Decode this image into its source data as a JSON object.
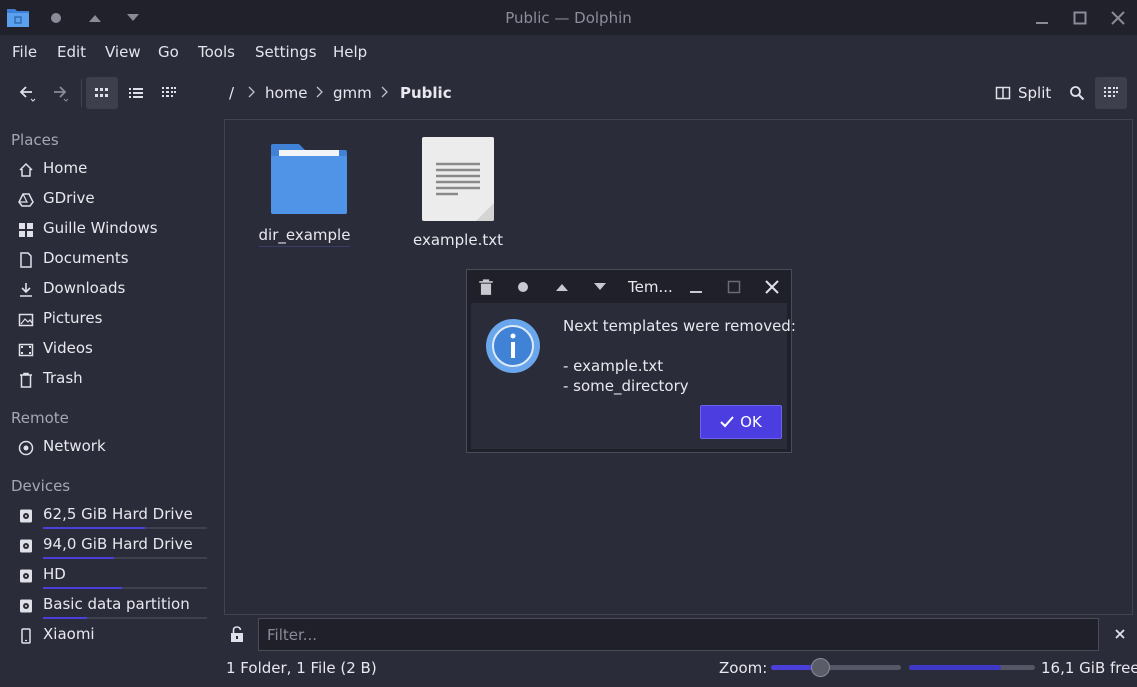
{
  "window": {
    "title": "Public — Dolphin"
  },
  "menu": [
    "File",
    "Edit",
    "View",
    "Go",
    "Tools",
    "Settings",
    "Help"
  ],
  "breadcrumb": {
    "root": "/",
    "items": [
      "home",
      "gmm"
    ],
    "current": "Public"
  },
  "toolbar": {
    "split_label": "Split"
  },
  "sidebar": {
    "places_title": "Places",
    "places": [
      {
        "label": "Home",
        "icon": "home-icon"
      },
      {
        "label": "GDrive",
        "icon": "gdrive-icon"
      },
      {
        "label": "Guille Windows",
        "icon": "windows-icon"
      },
      {
        "label": "Documents",
        "icon": "document-icon"
      },
      {
        "label": "Downloads",
        "icon": "download-icon"
      },
      {
        "label": "Pictures",
        "icon": "picture-icon"
      },
      {
        "label": "Videos",
        "icon": "video-icon"
      },
      {
        "label": "Trash",
        "icon": "trash-icon"
      }
    ],
    "remote_title": "Remote",
    "remote": [
      {
        "label": "Network",
        "icon": "network-icon"
      }
    ],
    "devices_title": "Devices",
    "devices": [
      {
        "label": "62,5 GiB Hard Drive",
        "icon": "hard-drive-icon",
        "usage": 0.62
      },
      {
        "label": "94,0 GiB Hard Drive",
        "icon": "hard-drive-icon",
        "usage": 0.43
      },
      {
        "label": "HD",
        "icon": "hard-drive-icon",
        "usage": 0.48
      },
      {
        "label": "Basic data partition",
        "icon": "hard-drive-icon",
        "usage": 0.27
      },
      {
        "label": "Xiaomi",
        "icon": "phone-icon"
      }
    ]
  },
  "files": [
    {
      "name": "dir_example",
      "type": "folder"
    },
    {
      "name": "example.txt",
      "type": "text"
    }
  ],
  "dialog": {
    "title": "Tem...",
    "message": "Next templates were removed:",
    "items": [
      "- example.txt",
      "- some_directory"
    ],
    "ok_label": "OK"
  },
  "filter": {
    "placeholder": "Filter..."
  },
  "status": {
    "summary": "1 Folder, 1 File (2 B)",
    "zoom_label": "Zoom:",
    "zoom_level": 0.38,
    "free_space": "16,1 GiB free",
    "space_used": 0.73
  },
  "colors": {
    "accent": "#4b3de0",
    "folder": "#4a8fe0",
    "background": "#2a2c39"
  }
}
